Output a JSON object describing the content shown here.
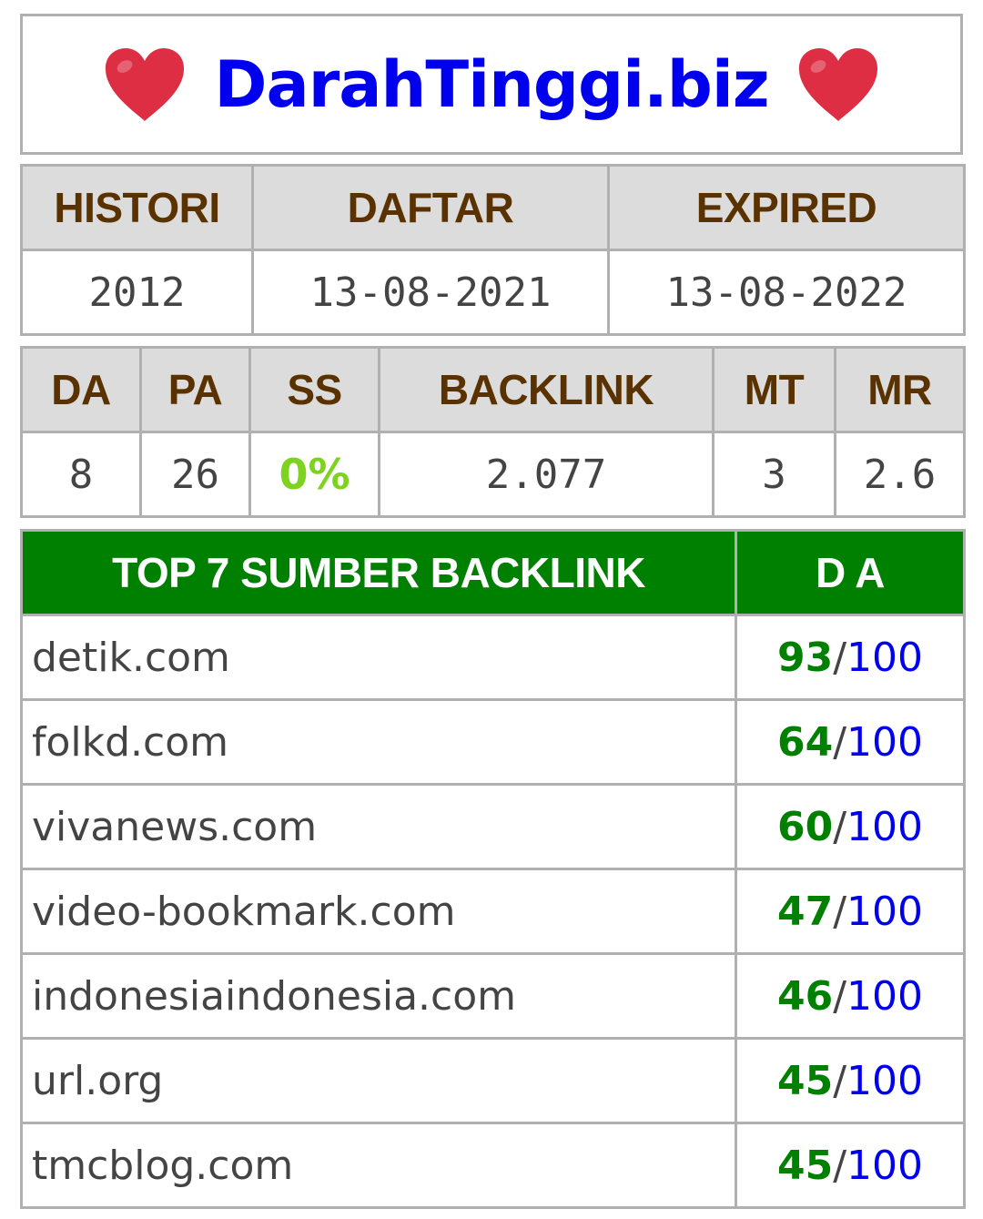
{
  "title": {
    "site_name": "DarahTinggi.biz",
    "left_icon": "heart-icon",
    "right_icon": "heart-icon",
    "heart_color": "#dd2e44"
  },
  "registration": {
    "headers": [
      "HISTORI",
      "DAFTAR",
      "EXPIRED"
    ],
    "values": [
      "2012",
      "13-08-2021",
      "13-08-2022"
    ]
  },
  "metrics": {
    "headers": [
      "DA",
      "PA",
      "SS",
      "BACKLINK",
      "MT",
      "MR"
    ],
    "values": [
      "8",
      "26",
      "0%",
      "2.077",
      "3",
      "2.6"
    ]
  },
  "backlinks": {
    "header_source": "TOP 7 SUMBER BACKLINK",
    "header_da": "D A",
    "separator": "/",
    "rows": [
      {
        "domain": "detik.com",
        "da": "93",
        "max": "100"
      },
      {
        "domain": "folkd.com",
        "da": "64",
        "max": "100"
      },
      {
        "domain": "vivanews.com",
        "da": "60",
        "max": "100"
      },
      {
        "domain": "video-bookmark.com",
        "da": "47",
        "max": "100"
      },
      {
        "domain": "indonesiaindonesia.com",
        "da": "46",
        "max": "100"
      },
      {
        "domain": "url.org",
        "da": "45",
        "max": "100"
      },
      {
        "domain": "tmcblog.com",
        "da": "45",
        "max": "100"
      }
    ]
  },
  "colors": {
    "title_blue": "#0000ee",
    "header_brown": "#5a3200",
    "header_gray": "#dcdcdc",
    "green_header": "#008000",
    "ss_green": "#7ed321",
    "border": "#b0b0b0"
  }
}
